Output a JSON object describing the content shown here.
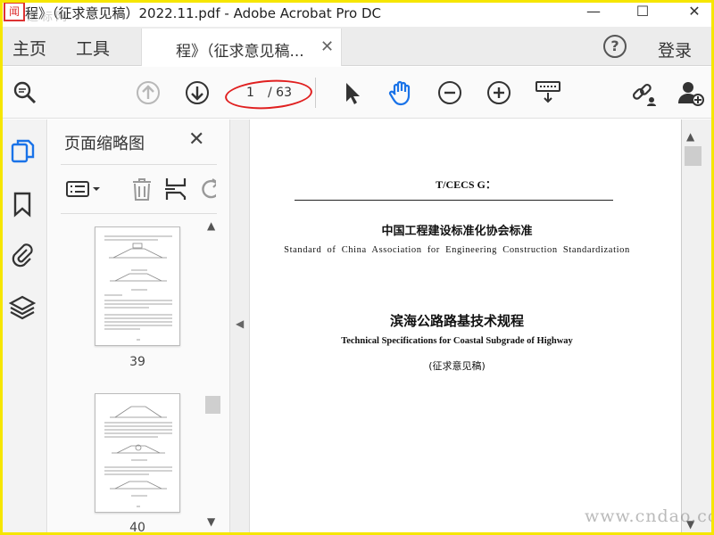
{
  "window": {
    "title": "程》（征求意见稿）2022.11.pdf - Adobe Acrobat Pro DC",
    "minimize": "—",
    "maximize": "☐",
    "close": "✕"
  },
  "watermark": {
    "logo_text": "闻",
    "top_text": "道标网",
    "bottom_text": "www.cndao.com"
  },
  "menu": {
    "home": "主页",
    "tools": "工具",
    "tab_label": "程》（征求意见稿...",
    "tab_close": "✕",
    "help": "?",
    "login": "登录"
  },
  "toolbar": {
    "current_page": "1",
    "total_pages": "/ 63",
    "icons": [
      "search-icon",
      "page-up-icon",
      "page-down-icon",
      "select-cursor-icon",
      "hand-tool-icon",
      "zoom-out-icon",
      "zoom-in-icon",
      "keyboard-icon",
      "share-link-icon",
      "add-user-icon"
    ],
    "accent_color": "#1a73e8"
  },
  "rail": {
    "icons": [
      "page-thumbnails-icon",
      "bookmark-icon",
      "attachment-icon",
      "layers-icon"
    ]
  },
  "thumbnails": {
    "title": "页面缩略图",
    "close": "✕",
    "pages": [
      {
        "number": "39"
      },
      {
        "number": "40"
      }
    ]
  },
  "document": {
    "code": "T/CECS G：",
    "association_cn": "中国工程建设标准化协会标准",
    "association_en": "Standard of China Association for Engineering Construction Standardization",
    "title_cn": "滨海公路路基技术规程",
    "title_en": "Technical Specifications for Coastal Subgrade of Highway",
    "draft_note": "(征求意见稿)"
  }
}
